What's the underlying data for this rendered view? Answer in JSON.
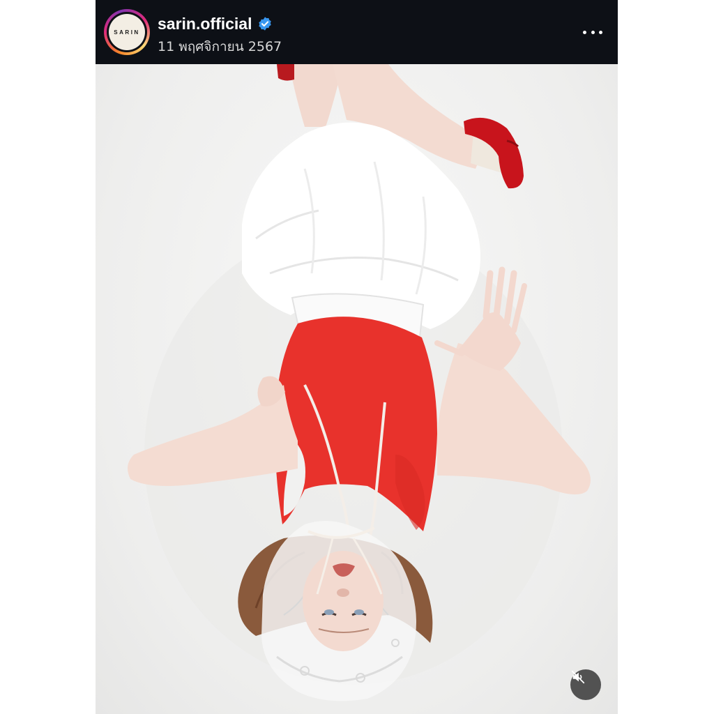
{
  "post": {
    "header": {
      "avatar_text": "SARIN",
      "username": "sarin.official",
      "verified": true,
      "date": "11 พฤศจิกายน 2567",
      "more_icon": "more-horizontal-icon"
    },
    "media": {
      "mute_icon": "speaker-muted-icon"
    }
  },
  "colors": {
    "header_bg": "#0d1016",
    "verified_blue": "#3897f0",
    "tank_top_red": "#e8322c",
    "shoe_red": "#c8141c",
    "skirt_white": "#ffffff",
    "background": "#f1f1f0"
  }
}
